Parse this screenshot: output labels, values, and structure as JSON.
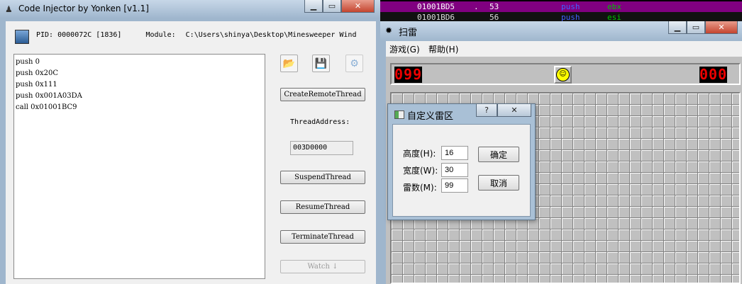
{
  "debugger": {
    "rows": [
      {
        "address": "01001BD5",
        "marker": ".",
        "bytes": "53",
        "mnemonic": "push",
        "operand": "ebx"
      },
      {
        "address": "01001BD6",
        "marker": "",
        "bytes": "56",
        "mnemonic": "push",
        "operand": "esi"
      }
    ]
  },
  "injector": {
    "title": "Code Injector by Yonken [v1.1]",
    "pid_label": "PID:",
    "pid_value": "0000072C [1836]",
    "module_label": "Module:",
    "module_value": "C:\\Users\\shinya\\Desktop\\Minesweeper Wind",
    "code_lines": [
      "push 0",
      "push 0x20C",
      "push 0x111",
      "push 0x001A03DA",
      "call 0x01001BC9"
    ],
    "buttons": {
      "create": "CreateRemoteThread",
      "suspend": "SuspendThread",
      "resume": "ResumeThread",
      "terminate": "TerminateThread",
      "watch": "Watch ↓"
    },
    "thread_address_label": "ThreadAddress:",
    "thread_address_value": "003D0000",
    "icons": [
      "open-folder-icon",
      "save-disk-icon",
      "gear-icon"
    ]
  },
  "minesweeper": {
    "title": "扫雷",
    "menu": [
      "游戏(G)",
      "帮助(H)"
    ],
    "mine_counter": "099",
    "timer": "000",
    "accent_red": "#e00000"
  },
  "dialog": {
    "title": "自定义雷区",
    "help_glyph": "?",
    "close_glyph": "✕",
    "fields": [
      {
        "label": "高度(H):",
        "value": "16"
      },
      {
        "label": "宽度(W):",
        "value": "30"
      },
      {
        "label": "雷数(M):",
        "value": "99"
      }
    ],
    "ok_label": "确定",
    "cancel_label": "取消"
  }
}
